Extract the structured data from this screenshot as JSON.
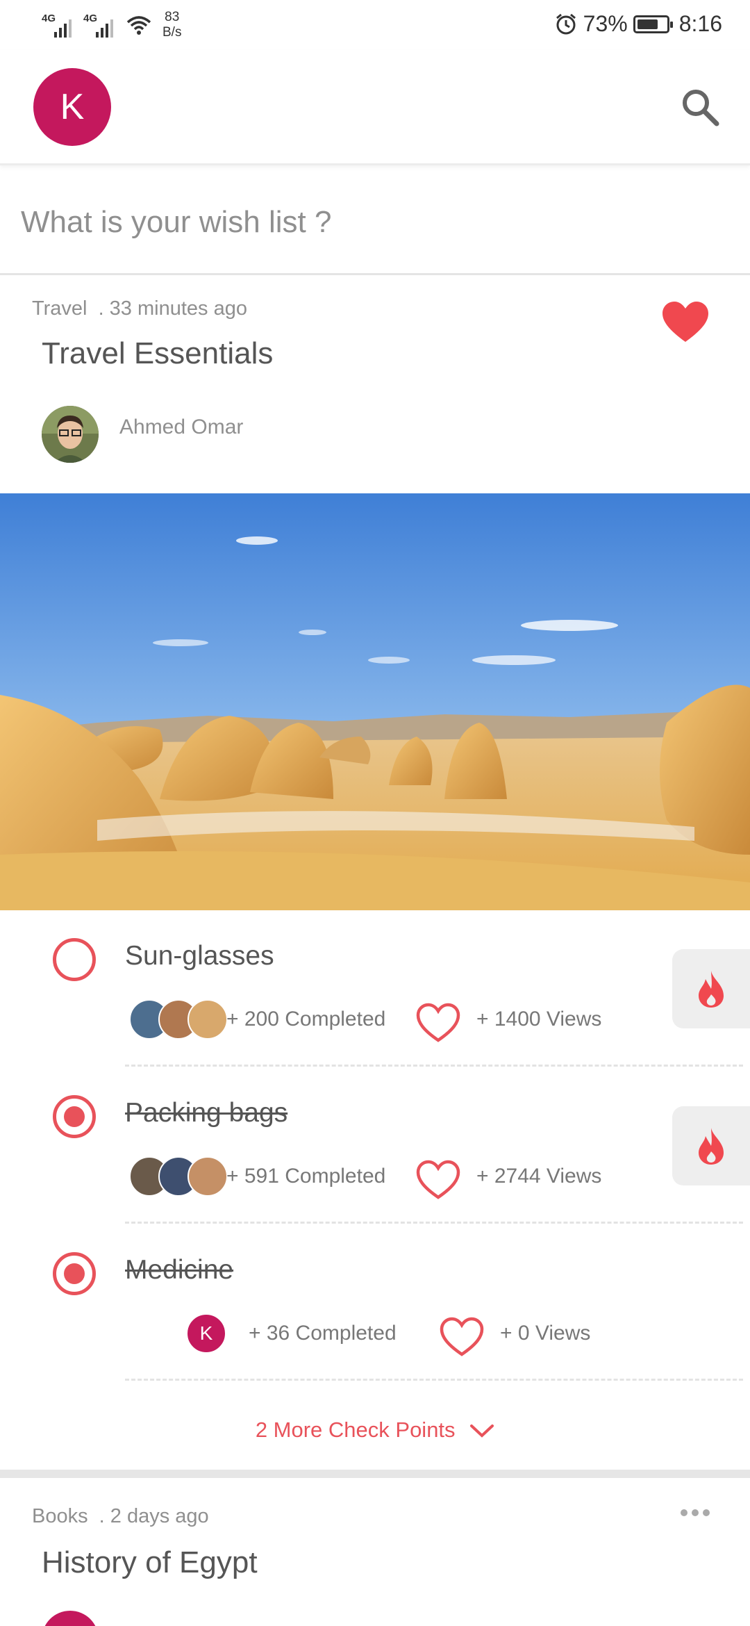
{
  "status_bar": {
    "network1": "4G",
    "network2": "4G",
    "speed_value": "83",
    "speed_unit": "B/s",
    "battery": "73%",
    "battery_level": 0.73,
    "time": "8:16"
  },
  "header": {
    "avatar_letter": "K",
    "search_icon": "search-icon"
  },
  "wish": {
    "placeholder": "What is your wish list ?"
  },
  "post": {
    "category": "Travel",
    "time_ago": ". 33 minutes ago",
    "title": "Travel Essentials",
    "author": "Ahmed Omar",
    "favorited": true
  },
  "checklist": [
    {
      "title": "Sun-glasses",
      "checked": false,
      "completed": "+ 200 Completed",
      "views": "+ 1400 Views"
    },
    {
      "title": "Packing bags",
      "checked": true,
      "completed": "+ 591 Completed",
      "views": "+ 2744 Views"
    },
    {
      "title": "Medicine",
      "checked": true,
      "avatar_letter": "K",
      "completed": "+ 36 Completed",
      "views": "+ 0 Views"
    }
  ],
  "more": {
    "label": "2 More Check Points"
  },
  "post2": {
    "category": "Books",
    "time_ago": ". 2 days ago",
    "title": "History of Egypt"
  },
  "colors": {
    "accent": "#e8525a",
    "brand": "#c4185d"
  }
}
